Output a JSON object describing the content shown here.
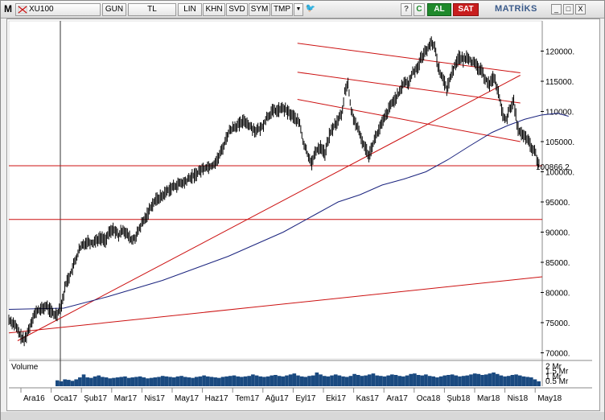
{
  "toolbar": {
    "menu_label": "M",
    "symbol": "XU100",
    "period": "GUN",
    "currency": "TL",
    "scale_lin": "LIN",
    "khn": "KHN",
    "svd": "SVD",
    "sym": "SYM",
    "tmp": "TMP",
    "dropdown_arrow": "▼",
    "twitter_glyph": "🐦",
    "refresh_glyph": "?",
    "c_label": "C",
    "settings_glyph": "⚙",
    "buy_label": "AL",
    "sell_label": "SAT",
    "brand": "MATRİKS",
    "minimize": "_",
    "maximize": "□",
    "close": "X"
  },
  "colors": {
    "price": "#000000",
    "moving_average": "#1a237e",
    "trendline": "#cc1111",
    "volume": "#1a4a80"
  },
  "chart_data": {
    "type": "line",
    "subtype": "ohlc-bars",
    "symbol": "XU100",
    "x_tick_labels": [
      "Ara16",
      "Oca17",
      "Şub17",
      "Mar17",
      "Nis17",
      "May17",
      "Haz17",
      "Tem17",
      "Ağu17",
      "Eyl17",
      "Eki17",
      "Kas17",
      "Ara17",
      "Oca18",
      "Şub18",
      "Mar18",
      "Nis18",
      "May18"
    ],
    "y_ticks": [
      70000,
      75000,
      80000,
      85000,
      90000,
      95000,
      100000,
      105000,
      110000,
      115000,
      120000
    ],
    "y_tick_labels": [
      "70000.",
      "75000.",
      "80000.",
      "85000.",
      "90000.",
      "95000.",
      "100000.",
      "105000.",
      "110000.",
      "115000.",
      "120000."
    ],
    "ylim": [
      69000,
      125000
    ],
    "last_price_label": "100866.2",
    "last_price": 100866.2,
    "price_series": [
      [
        0,
        75500
      ],
      [
        5,
        74800
      ],
      [
        10,
        73000
      ],
      [
        14,
        72000
      ],
      [
        18,
        73800
      ],
      [
        22,
        76000
      ],
      [
        26,
        77000
      ],
      [
        30,
        77200
      ],
      [
        34,
        77800
      ],
      [
        38,
        77000
      ],
      [
        41,
        76300
      ],
      [
        44,
        76500
      ],
      [
        48,
        78000
      ],
      [
        52,
        81500
      ],
      [
        56,
        83000
      ],
      [
        60,
        85000
      ],
      [
        64,
        87000
      ],
      [
        68,
        88000
      ],
      [
        72,
        88500
      ],
      [
        76,
        88200
      ],
      [
        80,
        88800
      ],
      [
        84,
        89000
      ],
      [
        88,
        88700
      ],
      [
        92,
        90000
      ],
      [
        96,
        90500
      ],
      [
        100,
        89300
      ],
      [
        104,
        90600
      ],
      [
        108,
        89500
      ],
      [
        112,
        88600
      ],
      [
        116,
        89300
      ],
      [
        120,
        91000
      ],
      [
        125,
        92500
      ],
      [
        130,
        94500
      ],
      [
        135,
        95500
      ],
      [
        140,
        96000
      ],
      [
        145,
        97000
      ],
      [
        150,
        97500
      ],
      [
        155,
        98000
      ],
      [
        160,
        98200
      ],
      [
        165,
        99000
      ],
      [
        170,
        99500
      ],
      [
        175,
        100300
      ],
      [
        180,
        100800
      ],
      [
        185,
        101000
      ],
      [
        190,
        102000
      ],
      [
        195,
        104000
      ],
      [
        200,
        106500
      ],
      [
        205,
        107500
      ],
      [
        210,
        107800
      ],
      [
        215,
        108500
      ],
      [
        220,
        107500
      ],
      [
        225,
        106800
      ],
      [
        230,
        107200
      ],
      [
        235,
        109000
      ],
      [
        240,
        110000
      ],
      [
        245,
        110200
      ],
      [
        250,
        110500
      ],
      [
        255,
        109800
      ],
      [
        260,
        109000
      ],
      [
        265,
        108000
      ],
      [
        268,
        105000
      ],
      [
        272,
        103000
      ],
      [
        276,
        101500
      ],
      [
        280,
        103500
      ],
      [
        284,
        104200
      ],
      [
        288,
        103000
      ],
      [
        292,
        106000
      ],
      [
        296,
        107500
      ],
      [
        300,
        108500
      ],
      [
        304,
        110000
      ],
      [
        306,
        113500
      ],
      [
        309,
        114500
      ],
      [
        312,
        110000
      ],
      [
        316,
        108000
      ],
      [
        320,
        106000
      ],
      [
        324,
        104200
      ],
      [
        328,
        102800
      ],
      [
        332,
        104800
      ],
      [
        336,
        106500
      ],
      [
        340,
        108000
      ],
      [
        344,
        109500
      ],
      [
        348,
        111000
      ],
      [
        352,
        112200
      ],
      [
        356,
        113000
      ],
      [
        360,
        115000
      ],
      [
        364,
        114500
      ],
      [
        368,
        116500
      ],
      [
        372,
        117200
      ],
      [
        376,
        119000
      ],
      [
        380,
        120000
      ],
      [
        384,
        121300
      ],
      [
        388,
        120800
      ],
      [
        391,
        117500
      ],
      [
        395,
        115500
      ],
      [
        399,
        113800
      ],
      [
        403,
        116000
      ],
      [
        407,
        118000
      ],
      [
        410,
        119000
      ],
      [
        414,
        118500
      ],
      [
        418,
        119200
      ],
      [
        422,
        118200
      ],
      [
        426,
        117500
      ],
      [
        430,
        116800
      ],
      [
        434,
        115500
      ],
      [
        438,
        114500
      ],
      [
        442,
        115800
      ],
      [
        446,
        113000
      ],
      [
        450,
        109500
      ],
      [
        454,
        108500
      ],
      [
        456,
        110500
      ],
      [
        460,
        111500
      ],
      [
        464,
        107000
      ],
      [
        468,
        106000
      ],
      [
        472,
        105500
      ],
      [
        476,
        104000
      ],
      [
        480,
        103000
      ],
      [
        482,
        101500
      ],
      [
        484,
        100866
      ]
    ],
    "ma_series": [
      [
        0,
        77200
      ],
      [
        50,
        77400
      ],
      [
        90,
        79300
      ],
      [
        140,
        82000
      ],
      [
        200,
        86000
      ],
      [
        250,
        90000
      ],
      [
        280,
        93000
      ],
      [
        300,
        95000
      ],
      [
        320,
        96200
      ],
      [
        340,
        97800
      ],
      [
        360,
        98800
      ],
      [
        380,
        100000
      ],
      [
        400,
        102000
      ],
      [
        420,
        104300
      ],
      [
        440,
        106500
      ],
      [
        455,
        107700
      ],
      [
        470,
        108700
      ],
      [
        485,
        109400
      ],
      [
        500,
        109700
      ],
      [
        510,
        109200
      ]
    ],
    "trendlines": [
      {
        "name": "support-long",
        "from": [
          0,
          73300
        ],
        "to": [
          730,
          82600
        ]
      },
      {
        "name": "support-steep",
        "from": [
          12,
          72000
        ],
        "to": [
          700,
          116000
        ]
      },
      {
        "name": "channel-upper",
        "from": [
          395,
          121300
        ],
        "to": [
          700,
          116400
        ]
      },
      {
        "name": "channel-mid",
        "from": [
          395,
          116500
        ],
        "to": [
          700,
          111400
        ]
      },
      {
        "name": "channel-lower",
        "from": [
          395,
          112000
        ],
        "to": [
          700,
          105000
        ]
      },
      {
        "name": "horizontal-101k",
        "from": [
          0,
          101000
        ],
        "to": [
          730,
          101000
        ]
      },
      {
        "name": "horizontal-92k",
        "from": [
          0,
          92100
        ],
        "to": [
          730,
          92100
        ]
      }
    ],
    "vertical_marker_x": 66,
    "volume": {
      "label": "Volume",
      "tick_labels": [
        "2 Mr",
        "1.5 Mr",
        "1 Mr",
        "0.5 Mr"
      ],
      "ticks": [
        2.0,
        1.5,
        1.0,
        0.5
      ],
      "ylim": [
        0,
        2.3
      ],
      "bars": [
        0.6,
        0.5,
        0.7,
        0.65,
        0.55,
        0.7,
        0.9,
        1.2,
        0.9,
        0.85,
        1.0,
        1.1,
        0.95,
        0.9,
        0.8,
        0.85,
        0.9,
        0.95,
        1.0,
        0.85,
        0.9,
        0.95,
        1.0,
        0.9,
        0.8,
        0.85,
        0.9,
        0.95,
        1.05,
        1.0,
        0.95,
        0.9,
        1.0,
        1.05,
        0.95,
        0.9,
        0.85,
        0.95,
        1.0,
        1.1,
        1.0,
        0.95,
        0.9,
        0.85,
        0.95,
        1.0,
        1.05,
        1.1,
        1.0,
        0.95,
        1.0,
        1.05,
        1.2,
        1.1,
        1.0,
        0.95,
        1.0,
        1.1,
        1.15,
        1.05,
        1.0,
        1.1,
        1.2,
        1.3,
        1.1,
        1.0,
        0.95,
        1.05,
        1.1,
        1.4,
        1.2,
        1.05,
        1.0,
        1.1,
        1.2,
        1.1,
        1.0,
        0.95,
        1.05,
        1.25,
        1.15,
        1.05,
        1.1,
        1.2,
        1.3,
        1.1,
        1.05,
        1.0,
        1.1,
        1.2,
        1.15,
        1.05,
        1.0,
        1.1,
        1.25,
        1.3,
        1.15,
        1.1,
        1.2,
        1.05,
        1.0,
        0.9,
        1.0,
        1.1,
        1.15,
        1.2,
        1.1,
        1.0,
        1.05,
        1.1,
        1.2,
        1.3,
        1.25,
        1.15,
        1.2,
        1.3,
        1.4,
        1.25,
        1.1,
        1.0,
        1.05,
        1.15,
        1.2,
        1.1,
        1.0,
        0.95,
        0.9,
        0.7,
        0.5
      ]
    }
  }
}
